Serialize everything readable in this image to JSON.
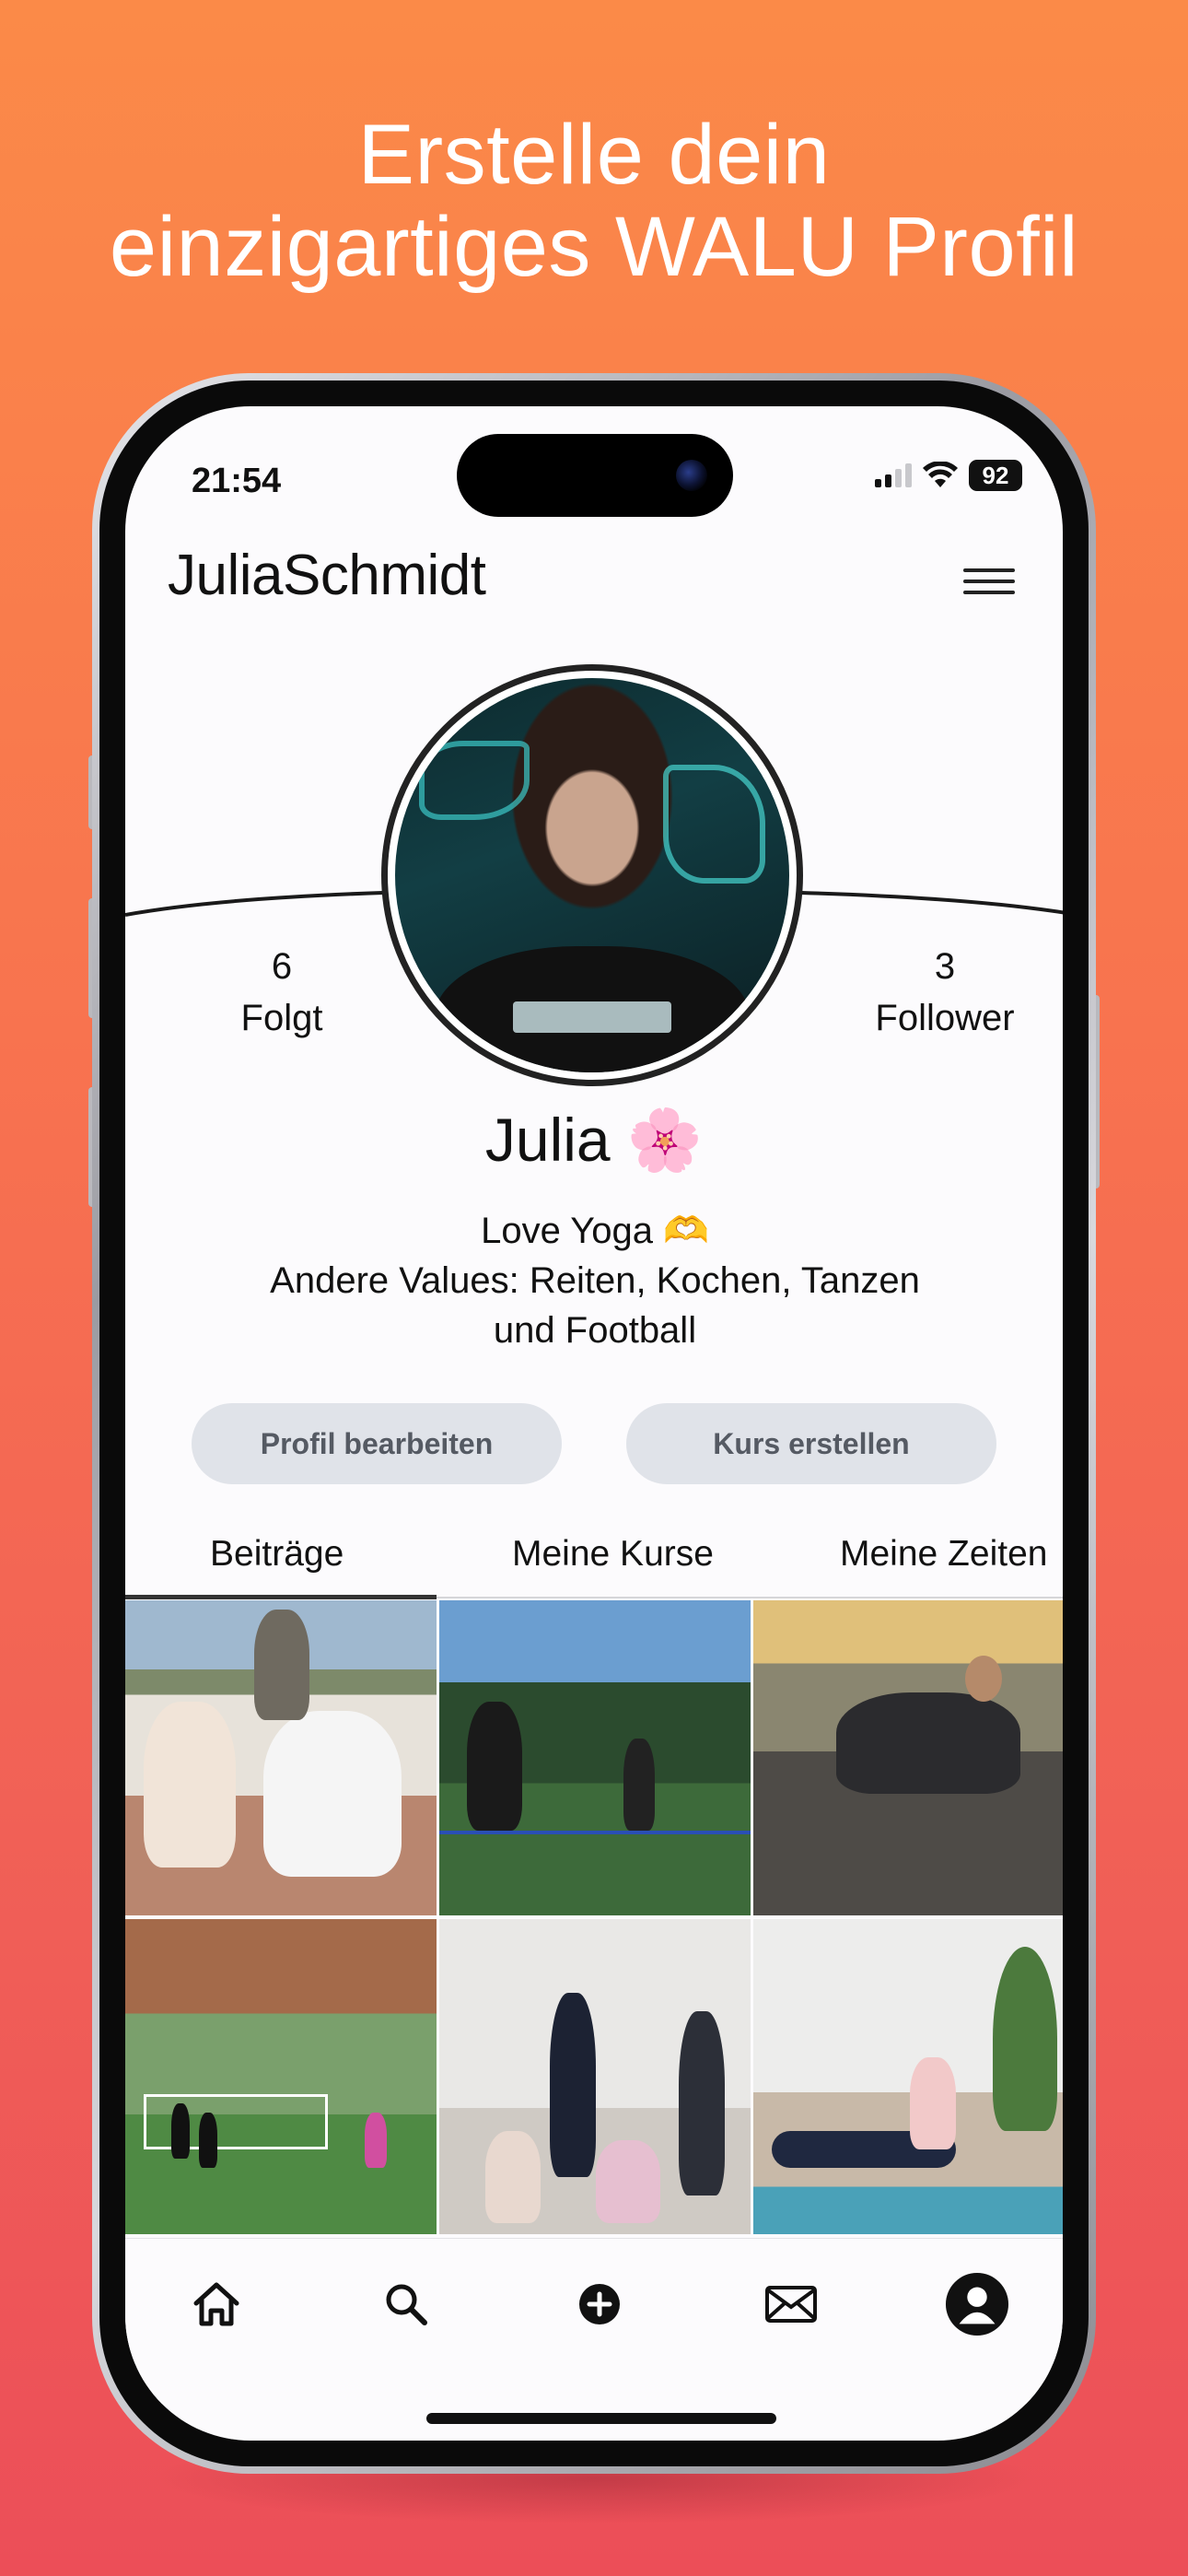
{
  "headline": {
    "line1": "Erstelle dein",
    "line2": "einzigartiges WALU Profil"
  },
  "status_bar": {
    "time": "21:54",
    "battery": "92"
  },
  "profile": {
    "username": "JuliaSchmidt",
    "following_count": "6",
    "following_label": "Folgt",
    "follower_count": "3",
    "follower_label": "Follower",
    "display_name": "Julia 🌸",
    "bio_line1": "Love Yoga 🫶",
    "bio_line2": "Andere Values: Reiten, Kochen, Tanzen",
    "bio_line3": "und Football"
  },
  "actions": {
    "edit_profile": "Profil bearbeiten",
    "create_course": "Kurs erstellen"
  },
  "tabs": [
    {
      "label": "Beiträge",
      "active": true
    },
    {
      "label": "Meine Kurse",
      "active": false
    },
    {
      "label": "Meine Zeiten",
      "active": false
    }
  ],
  "posts": [
    {
      "icon": "photo-outdoor-group"
    },
    {
      "icon": "photo-soccer-field"
    },
    {
      "icon": "photo-yoga-outdoor"
    },
    {
      "icon": "photo-football-training"
    },
    {
      "icon": "photo-yoga-studio-group"
    },
    {
      "icon": "photo-yoga-studio"
    }
  ],
  "bottom_nav": [
    {
      "icon": "home-icon"
    },
    {
      "icon": "search-icon"
    },
    {
      "icon": "add-icon"
    },
    {
      "icon": "mail-icon"
    },
    {
      "icon": "profile-icon"
    }
  ],
  "colors": {
    "gradient_top": "#fb8a48",
    "gradient_bottom": "#ec4e58",
    "button_bg": "#e0e3e9",
    "screen_bg": "#fcfbfd"
  }
}
